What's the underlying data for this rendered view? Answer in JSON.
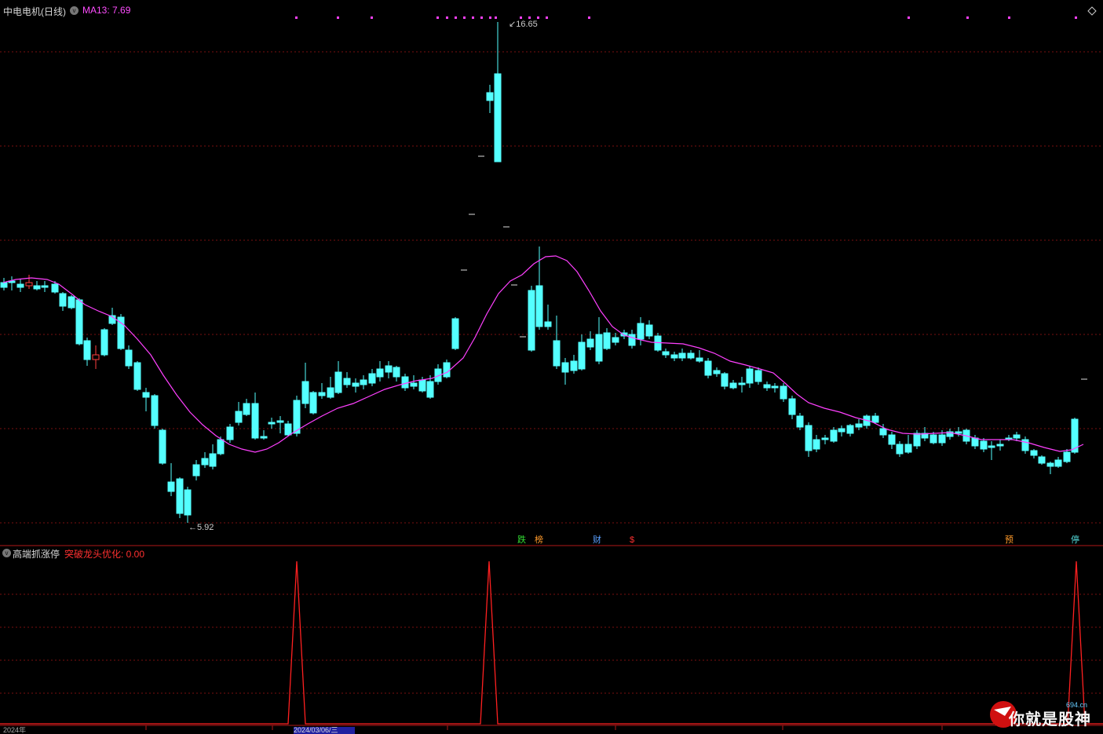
{
  "header": {
    "stock_title": "中电电机(日线)",
    "ma_label": "MA13: 7.69"
  },
  "indicator": {
    "name": "高端抓涨停",
    "value_label": "突破龙头优化: 0.00"
  },
  "annotations": {
    "high_label": "16.65",
    "low_label": "5.92"
  },
  "tags": [
    {
      "text": "跌",
      "color": "#33dd33"
    },
    {
      "text": "榜",
      "color": "#ff9a2a"
    },
    {
      "text": "财",
      "color": "#5aa0ff"
    },
    {
      "text": "$",
      "color": "#ff3030"
    },
    {
      "text": "预",
      "color": "#ff9a2a"
    },
    {
      "text": "停",
      "color": "#55dddd"
    }
  ],
  "footer": {
    "year_label": "2024年",
    "selected_date": "2024/03/06/三"
  },
  "watermark": {
    "text": "你就是股神",
    "site": "694.cn"
  },
  "colors": {
    "up": "#ff4040",
    "down": "#54ffff",
    "ma": "#ff40ff",
    "indicator": "#ff2020",
    "grid": "#7a1010"
  },
  "chart_data": {
    "type": "candlestick",
    "price_range": [
      5.92,
      16.65
    ],
    "ma_period": 13,
    "ma_current": 7.69,
    "high": 16.65,
    "low": 5.92,
    "indicator_peaks": 3
  }
}
